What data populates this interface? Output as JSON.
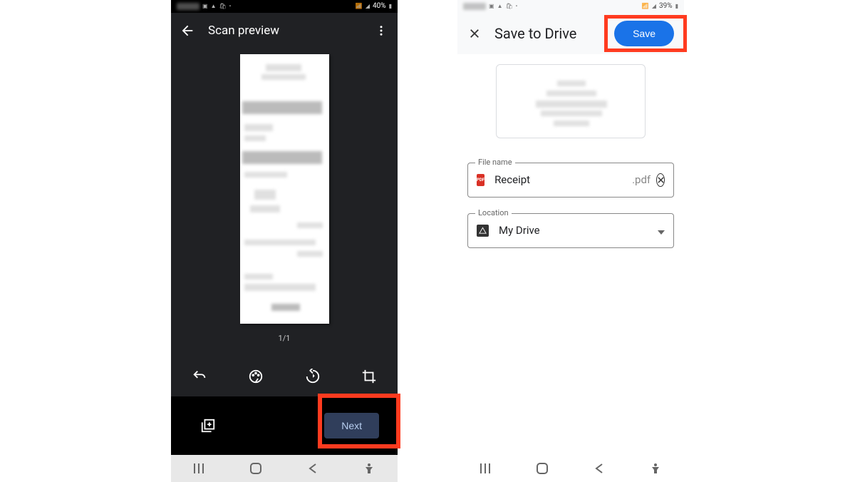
{
  "left": {
    "status_battery": "40%",
    "title": "Scan preview",
    "page_counter": "1/1",
    "next_label": "Next"
  },
  "right": {
    "status_battery": "39%",
    "title": "Save to Drive",
    "save_label": "Save",
    "filename_label": "File name",
    "filename_value": "Receipt",
    "filename_ext": ".pdf",
    "location_label": "Location",
    "location_value": "My Drive"
  }
}
